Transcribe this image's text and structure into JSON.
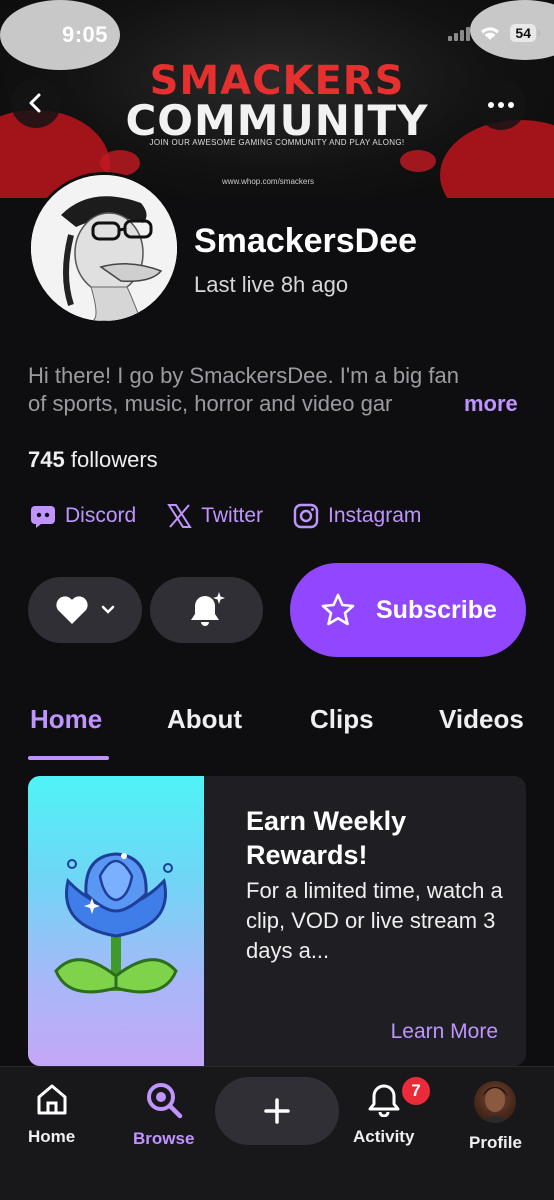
{
  "status_bar": {
    "time": "9:05",
    "battery": "54"
  },
  "banner": {
    "title_line1": "SMACKERS",
    "title_line2": "COMMUNITY",
    "tagline": "JOIN OUR AWESOME GAMING COMMUNITY AND PLAY ALONG!",
    "url": "www.whop.com/smackers"
  },
  "profile": {
    "name": "SmackersDee",
    "last_live": "Last live 8h ago",
    "bio_line1": "Hi there! I go by SmackersDee. I'm a big fan",
    "bio_line2": "of sports, music, horror and video gar",
    "bio_more": "more",
    "followers_count": "745",
    "followers_label": "followers"
  },
  "socials": [
    {
      "label": "Discord",
      "icon": "discord-icon"
    },
    {
      "label": "Twitter",
      "icon": "x-twitter-icon"
    },
    {
      "label": "Instagram",
      "icon": "instagram-icon"
    }
  ],
  "actions": {
    "subscribe_label": "Subscribe"
  },
  "tabs": [
    {
      "label": "Home",
      "active": true
    },
    {
      "label": "About",
      "active": false
    },
    {
      "label": "Clips",
      "active": false
    },
    {
      "label": "Videos",
      "active": false
    }
  ],
  "promo_card": {
    "title": "Earn Weekly Rewards!",
    "body": "For a limited time, watch a clip, VOD or live stream 3 days a...",
    "link": "Learn More"
  },
  "bottom_nav": {
    "home": "Home",
    "browse": "Browse",
    "activity": "Activity",
    "activity_badge": "7",
    "profile": "Profile"
  },
  "colors": {
    "accent": "#9147ff",
    "accent_text": "#bf94ff",
    "background": "#0e0e10",
    "badge": "#eb2b3a"
  }
}
